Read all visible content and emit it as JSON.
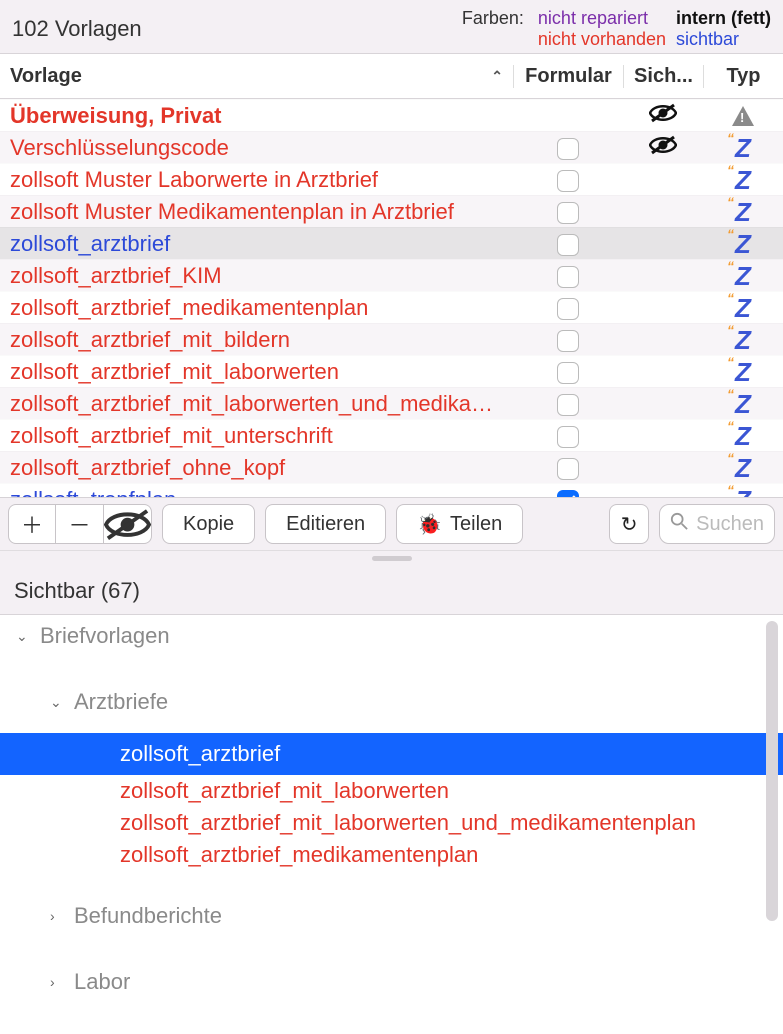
{
  "header": {
    "title": "102 Vorlagen",
    "legend_label": "Farben:",
    "legend_purple": "nicht repariert",
    "legend_red": "nicht vorhanden",
    "legend_bold": "intern (fett)",
    "legend_blue": "sichtbar"
  },
  "columns": {
    "name": "Vorlage",
    "form": "Formular",
    "sich": "Sich...",
    "typ": "Typ"
  },
  "rows": [
    {
      "name": "Überweisung, Privat",
      "cls": "name-red-bold",
      "form": "",
      "sich": "eye",
      "typ": "warn",
      "striped": false
    },
    {
      "name": "Verschlüsselungscode",
      "cls": "name-red",
      "form": "check",
      "sich": "eye",
      "typ": "z",
      "striped": true
    },
    {
      "name": "zollsoft Muster Laborwerte in Arztbrief",
      "cls": "name-red",
      "form": "check",
      "sich": "",
      "typ": "z",
      "striped": false
    },
    {
      "name": "zollsoft Muster Medikamentenplan in Arztbrief",
      "cls": "name-red",
      "form": "check",
      "sich": "",
      "typ": "z",
      "striped": true
    },
    {
      "name": "zollsoft_arztbrief",
      "cls": "name-blue",
      "form": "check",
      "sich": "",
      "typ": "z",
      "striped": false,
      "selected": true
    },
    {
      "name": "zollsoft_arztbrief_KIM",
      "cls": "name-red",
      "form": "check",
      "sich": "",
      "typ": "z",
      "striped": true
    },
    {
      "name": "zollsoft_arztbrief_medikamentenplan",
      "cls": "name-red",
      "form": "check",
      "sich": "",
      "typ": "z",
      "striped": false
    },
    {
      "name": "zollsoft_arztbrief_mit_bildern",
      "cls": "name-red",
      "form": "check",
      "sich": "",
      "typ": "z",
      "striped": true
    },
    {
      "name": "zollsoft_arztbrief_mit_laborwerten",
      "cls": "name-red",
      "form": "check",
      "sich": "",
      "typ": "z",
      "striped": false
    },
    {
      "name": "zollsoft_arztbrief_mit_laborwerten_und_medikam...",
      "cls": "name-red",
      "form": "check",
      "sich": "",
      "typ": "z",
      "striped": true
    },
    {
      "name": "zollsoft_arztbrief_mit_unterschrift",
      "cls": "name-red",
      "form": "check",
      "sich": "",
      "typ": "z",
      "striped": false
    },
    {
      "name": "zollsoft_arztbrief_ohne_kopf",
      "cls": "name-red",
      "form": "check",
      "sich": "",
      "typ": "z",
      "striped": true
    },
    {
      "name": "zollsoft_tropfplan",
      "cls": "name-blue",
      "form": "check-on",
      "sich": "",
      "typ": "z",
      "striped": false
    }
  ],
  "toolbar": {
    "kopie": "Kopie",
    "editieren": "Editieren",
    "teilen": "Teilen",
    "search_placeholder": "Suchen"
  },
  "section2": {
    "title": "Sichtbar (67)",
    "group1": "Briefvorlagen",
    "group2": "Arztbriefe",
    "leaf1": "zollsoft_arztbrief",
    "leaf2": "zollsoft_arztbrief_mit_laborwerten",
    "leaf3": "zollsoft_arztbrief_mit_laborwerten_und_medikamentenplan",
    "leaf4": "zollsoft_arztbrief_medikamentenplan",
    "group3": "Befundberichte",
    "group4": "Labor"
  }
}
